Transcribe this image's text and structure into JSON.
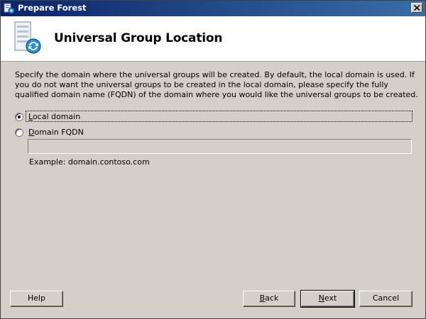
{
  "window": {
    "title": "Prepare Forest"
  },
  "header": {
    "title": "Universal Group Location"
  },
  "content": {
    "description": "Specify the domain where the universal groups will be created. By default, the local domain is used. If you do not want the universal groups to be created in the local domain, please specify the fully qualified domain name (FQDN) of the domain where you would like the universal groups to be created.",
    "options": [
      {
        "label_accel": "L",
        "label_rest": "ocal domain",
        "selected": true
      },
      {
        "label_accel": "D",
        "label_rest": "omain FQDN",
        "selected": false
      }
    ],
    "fqdn_value": "",
    "example": "Example: domain.contoso.com"
  },
  "buttons": {
    "help": "Help",
    "back_accel": "B",
    "back_rest": "ack",
    "next_accel": "N",
    "next_rest": "ext",
    "cancel": "Cancel"
  }
}
